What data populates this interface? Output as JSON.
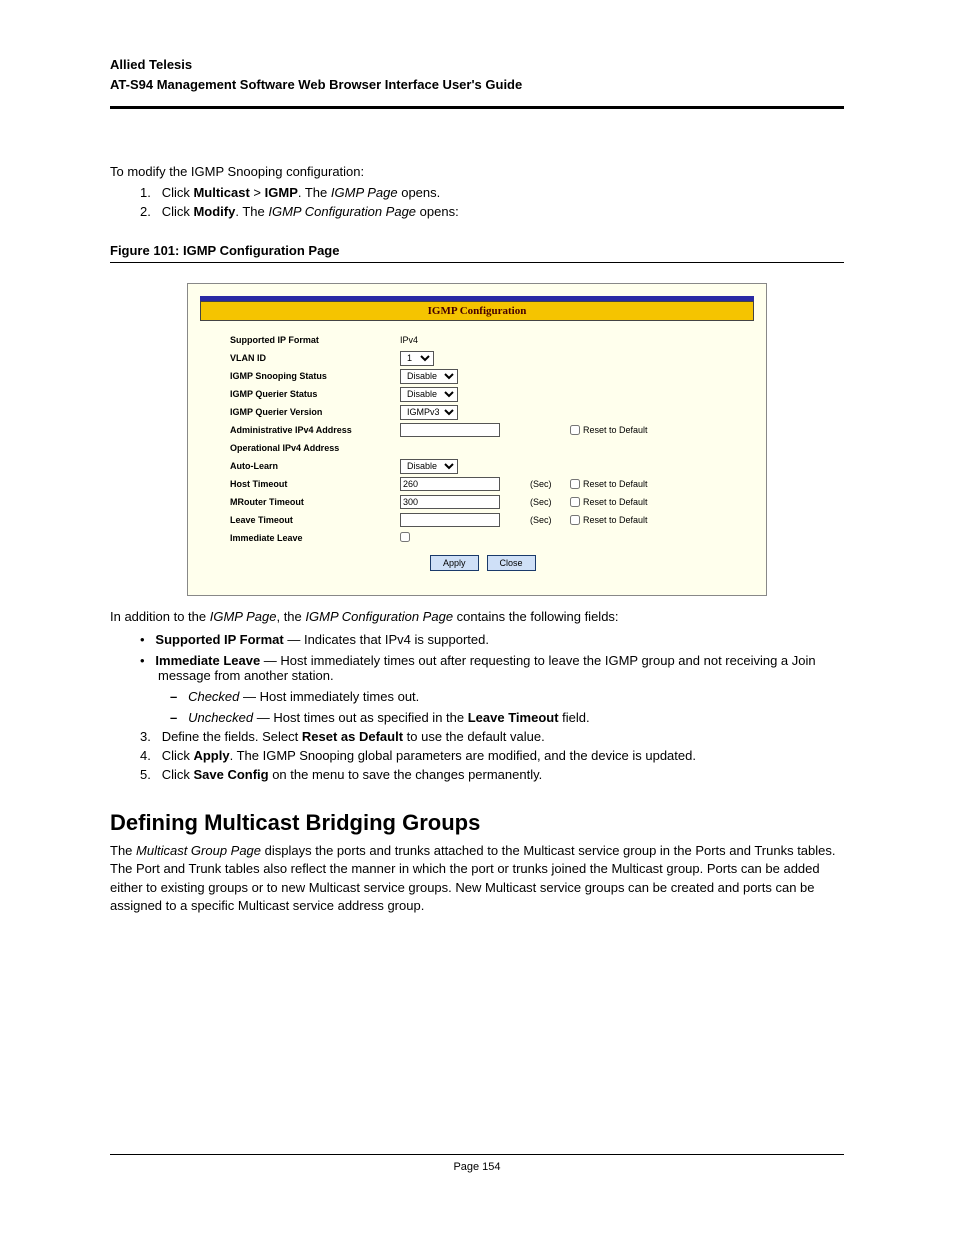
{
  "header": {
    "company": "Allied Telesis",
    "title": "AT-S94 Management Software Web Browser Interface User's Guide"
  },
  "intro": "To modify the IGMP Snooping configuration:",
  "step1_num": "1.",
  "step1_a": "Click ",
  "step1_b": "Multicast",
  "step1_c": " > ",
  "step1_d": "IGMP",
  "step1_e": ". The ",
  "step1_f": "IGMP Page",
  "step1_g": " opens.",
  "step2_num": "2.",
  "step2_a": "Click ",
  "step2_b": "Modify",
  "step2_c": ". The ",
  "step2_d": "IGMP Configuration Page",
  "step2_e": " opens:",
  "figcap_prefix": "Figure 101:",
  "figcap_text": "IGMP Configuration Page",
  "dialog": {
    "title": "IGMP Configuration",
    "labels": {
      "supported": "Supported IP Format",
      "vlan": "VLAN ID",
      "snoop": "IGMP Snooping Status",
      "querier_status": "IGMP Querier Status",
      "querier_ver": "IGMP Querier Version",
      "admin_addr": "Administrative IPv4 Address",
      "oper_addr": "Operational IPv4 Address",
      "auto_learn": "Auto-Learn",
      "host_to": "Host Timeout",
      "mrouter_to": "MRouter Timeout",
      "leave_to": "Leave Timeout",
      "imm_leave": "Immediate Leave"
    },
    "values": {
      "supported": "IPv4",
      "vlan": "1",
      "snoop": "Disable",
      "querier_status": "Disable",
      "querier_ver": "IGMPv3",
      "admin_addr": "",
      "oper_addr": "",
      "auto_learn": "Disable",
      "host_to": "260",
      "mrouter_to": "300",
      "leave_to": ""
    },
    "sec_suffix": "(Sec)",
    "reset": "Reset to Default",
    "apply": "Apply",
    "close": "Close"
  },
  "after_fig_a": "In addition to the ",
  "after_fig_b": "IGMP Page",
  "after_fig_c": ", the ",
  "after_fig_d": "IGMP Configuration Page",
  "after_fig_e": " contains the following fields:",
  "b1_a": "Supported IP Format",
  "b1_b": " — Indicates that IPv4 is supported.",
  "b2_a": "Immediate Leave",
  "b2_b": " — Host immediately times out after requesting to leave the IGMP group and not receiving a Join message from another station.",
  "b2c_a": "Checked",
  "b2c_b": " — Host immediately times out.",
  "b2u_a": "Unchecked",
  "b2u_b": " — Host times out as specified in the ",
  "b2u_c": "Leave Timeout",
  "b2u_d": " field.",
  "step3_num": "3.",
  "step3_a": "Define the fields. Select ",
  "step3_b": "Reset as Default",
  "step3_c": " to use the default value.",
  "step4_num": "4.",
  "step4_a": "Click ",
  "step4_b": "Apply",
  "step4_c": ". The IGMP Snooping global parameters are modified, and the device is updated.",
  "step5_num": "5.",
  "step5_a": "Click ",
  "step5_b": "Save Config",
  "step5_c": " on the menu to save the changes permanently.",
  "h2": "Defining Multicast Bridging Groups",
  "para_a": "The ",
  "para_b": "Multicast Group Page",
  "para_c": " displays the ports and trunks attached to the Multicast service group in the Ports and Trunks tables. The Port and Trunk tables also reflect the manner in which the port or trunks joined the Multicast group. Ports can be added either to existing groups or to new Multicast service groups. New Multicast service groups can be created and ports can be assigned to a specific Multicast service address group.",
  "footer": "Page 154"
}
